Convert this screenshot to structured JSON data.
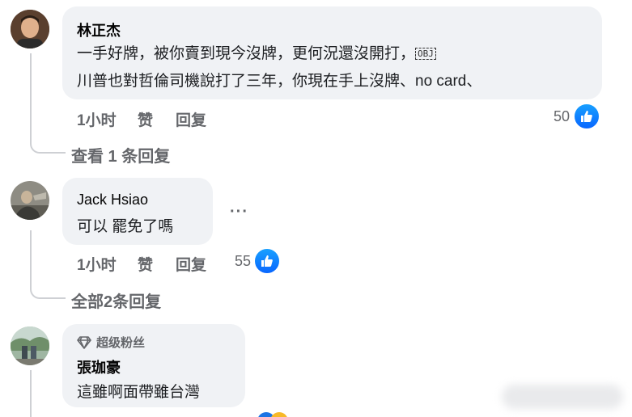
{
  "comments": [
    {
      "author": "林正杰",
      "lines": [
        "一手好牌，被你賣到現今沒牌，更何況還沒開打，",
        "川普也對哲倫司機說打了三年，你現在手上沒牌、no card、"
      ],
      "inline_object": "OBJ",
      "time": "1小时",
      "like_label": "赞",
      "reply_label": "回复",
      "reactions": "50",
      "replies_link": "查看 1 条回复"
    },
    {
      "author": "Jack Hsiao",
      "lines": [
        "可以 罷免了嗎"
      ],
      "more": "···",
      "time": "1小时",
      "like_label": "赞",
      "reply_label": "回复",
      "reactions": "55",
      "replies_link": "全部2条回复"
    },
    {
      "badge": "超级粉丝",
      "author": "張珈豪",
      "lines": [
        "這雖啊面帶雖台灣"
      ]
    }
  ],
  "colors": {
    "bubble": "#f0f2f5",
    "secondary_text": "#65676b",
    "like_blue": "#0866ff",
    "thread_line": "#ced0d4"
  },
  "icons": [
    "thumbs-up-icon",
    "diamond-icon",
    "more-options-icon"
  ]
}
